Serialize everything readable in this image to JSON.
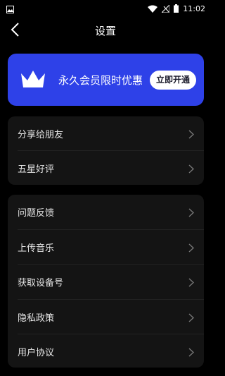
{
  "status_bar": {
    "time": "11:02"
  },
  "header": {
    "title": "设置"
  },
  "vip": {
    "text": "永久会员限时优惠",
    "button": "立即开通",
    "accent": "#2e41e8"
  },
  "group1": {
    "items": [
      {
        "label": "分享给朋友"
      },
      {
        "label": "五星好评"
      }
    ]
  },
  "group2": {
    "items": [
      {
        "label": "问题反馈"
      },
      {
        "label": "上传音乐"
      },
      {
        "label": "获取设备号"
      },
      {
        "label": "隐私政策"
      },
      {
        "label": "用户协议"
      }
    ]
  }
}
